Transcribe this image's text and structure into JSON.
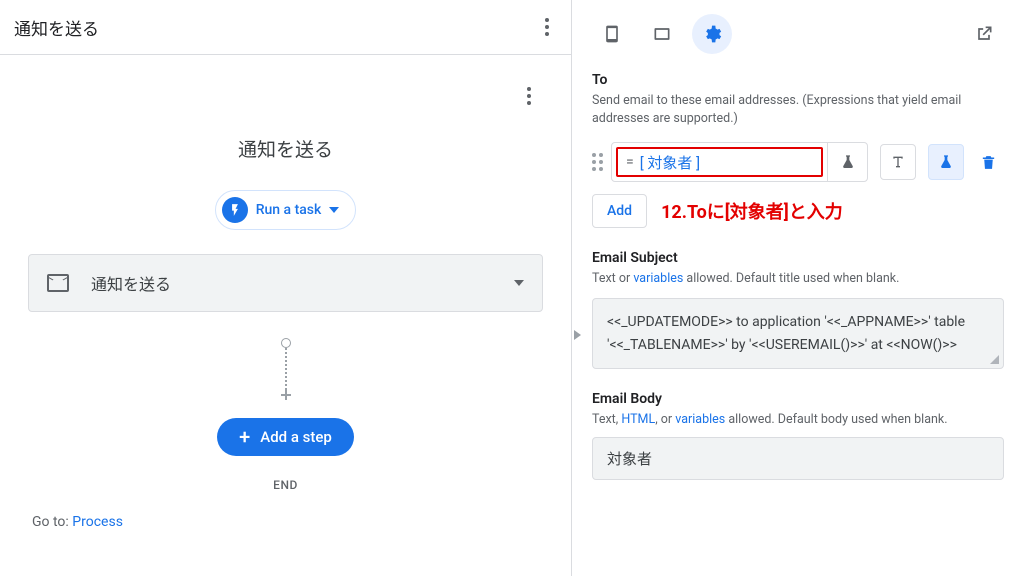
{
  "left": {
    "header_title": "通知を送る",
    "section_title": "通知を送る",
    "run_btn": "Run a task",
    "task_name": "通知を送る",
    "add_step": "Add a step",
    "end_label": "END",
    "goto_prefix": "Go to: ",
    "goto_link": "Process"
  },
  "right": {
    "to": {
      "label": "To",
      "help": "Send email to these email addresses. (Expressions that yield email addresses are supported.)",
      "value": "[ 対象者 ]",
      "add": "Add",
      "annotation": "12.Toに[対象者]と入力"
    },
    "subject": {
      "label": "Email Subject",
      "help_pre": "Text or ",
      "help_link": "variables",
      "help_post": " allowed. Default title used when blank.",
      "value": "<<_UPDATEMODE>> to application '<<_APPNAME>>' table '<<_TABLENAME>>' by '<<USEREMAIL()>>' at <<NOW()>>"
    },
    "body": {
      "label": "Email Body",
      "help_pre": "Text, ",
      "help_link1": "HTML",
      "help_mid": ", or ",
      "help_link2": "variables",
      "help_post": " allowed. Default body used when blank.",
      "value": "対象者"
    }
  }
}
